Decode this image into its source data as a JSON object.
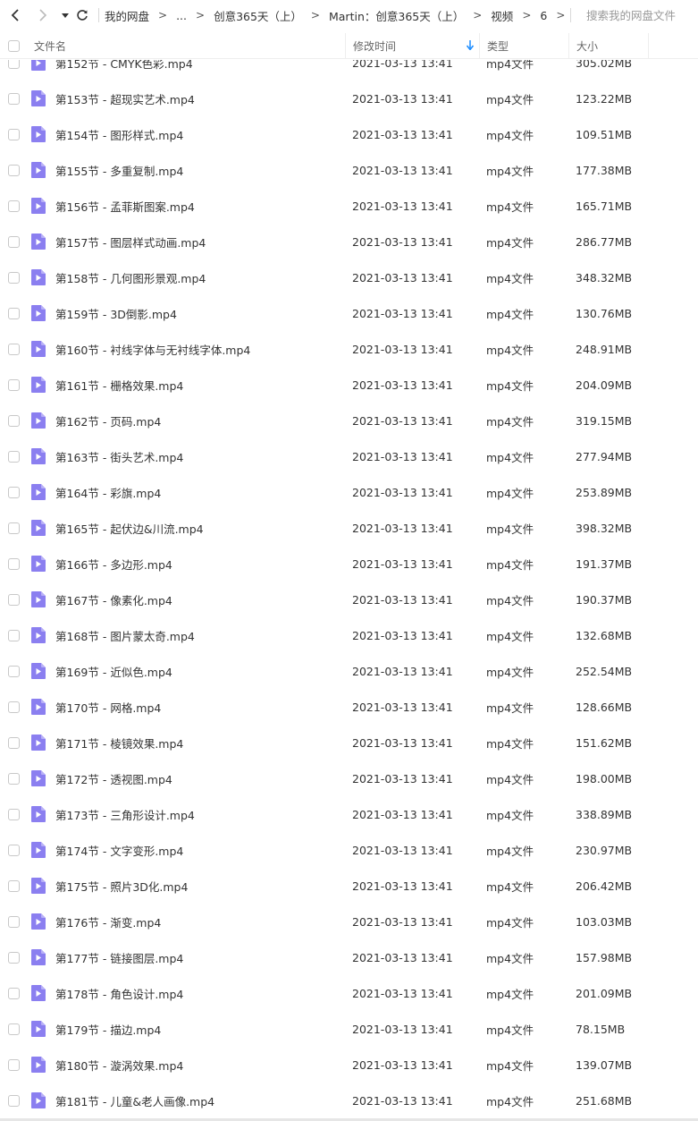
{
  "nav": {
    "back_icon": "chevron-left-icon",
    "forward_icon": "chevron-right-icon",
    "history_icon": "caret-down-icon",
    "refresh_icon": "refresh-icon"
  },
  "breadcrumb": [
    {
      "label": "我的网盘"
    },
    {
      "label": "..."
    },
    {
      "label": "创意365天（上）"
    },
    {
      "label": "Martin：创意365天（上）"
    },
    {
      "label": "视频"
    },
    {
      "label": "6"
    }
  ],
  "search": {
    "placeholder": "搜索我的网盘文件"
  },
  "columns": {
    "name": "文件名",
    "time": "修改时间",
    "type": "类型",
    "size": "大小"
  },
  "files": [
    {
      "name": "第152节 - CMYK色彩.mp4",
      "time": "2021-03-13 13:41",
      "type": "mp4文件",
      "size": "305.02MB"
    },
    {
      "name": "第153节 - 超现实艺术.mp4",
      "time": "2021-03-13 13:41",
      "type": "mp4文件",
      "size": "123.22MB"
    },
    {
      "name": "第154节 - 图形样式.mp4",
      "time": "2021-03-13 13:41",
      "type": "mp4文件",
      "size": "109.51MB"
    },
    {
      "name": "第155节 - 多重复制.mp4",
      "time": "2021-03-13 13:41",
      "type": "mp4文件",
      "size": "177.38MB"
    },
    {
      "name": "第156节 - 孟菲斯图案.mp4",
      "time": "2021-03-13 13:41",
      "type": "mp4文件",
      "size": "165.71MB"
    },
    {
      "name": "第157节 - 图层样式动画.mp4",
      "time": "2021-03-13 13:41",
      "type": "mp4文件",
      "size": "286.77MB"
    },
    {
      "name": "第158节 - 几何图形景观.mp4",
      "time": "2021-03-13 13:41",
      "type": "mp4文件",
      "size": "348.32MB"
    },
    {
      "name": "第159节 - 3D倒影.mp4",
      "time": "2021-03-13 13:41",
      "type": "mp4文件",
      "size": "130.76MB"
    },
    {
      "name": "第160节 - 衬线字体与无衬线字体.mp4",
      "time": "2021-03-13 13:41",
      "type": "mp4文件",
      "size": "248.91MB"
    },
    {
      "name": "第161节 - 栅格效果.mp4",
      "time": "2021-03-13 13:41",
      "type": "mp4文件",
      "size": "204.09MB"
    },
    {
      "name": "第162节 - 页码.mp4",
      "time": "2021-03-13 13:41",
      "type": "mp4文件",
      "size": "319.15MB"
    },
    {
      "name": "第163节 - 街头艺术.mp4",
      "time": "2021-03-13 13:41",
      "type": "mp4文件",
      "size": "277.94MB"
    },
    {
      "name": "第164节 - 彩旗.mp4",
      "time": "2021-03-13 13:41",
      "type": "mp4文件",
      "size": "253.89MB"
    },
    {
      "name": "第165节 - 起伏边&川流.mp4",
      "time": "2021-03-13 13:41",
      "type": "mp4文件",
      "size": "398.32MB"
    },
    {
      "name": "第166节 - 多边形.mp4",
      "time": "2021-03-13 13:41",
      "type": "mp4文件",
      "size": "191.37MB"
    },
    {
      "name": "第167节 - 像素化.mp4",
      "time": "2021-03-13 13:41",
      "type": "mp4文件",
      "size": "190.37MB"
    },
    {
      "name": "第168节 - 图片蒙太奇.mp4",
      "time": "2021-03-13 13:41",
      "type": "mp4文件",
      "size": "132.68MB"
    },
    {
      "name": "第169节 - 近似色.mp4",
      "time": "2021-03-13 13:41",
      "type": "mp4文件",
      "size": "252.54MB"
    },
    {
      "name": "第170节 - 网格.mp4",
      "time": "2021-03-13 13:41",
      "type": "mp4文件",
      "size": "128.66MB"
    },
    {
      "name": "第171节 - 棱镜效果.mp4",
      "time": "2021-03-13 13:41",
      "type": "mp4文件",
      "size": "151.62MB"
    },
    {
      "name": "第172节 - 透视图.mp4",
      "time": "2021-03-13 13:41",
      "type": "mp4文件",
      "size": "198.00MB"
    },
    {
      "name": "第173节 - 三角形设计.mp4",
      "time": "2021-03-13 13:41",
      "type": "mp4文件",
      "size": "338.89MB"
    },
    {
      "name": "第174节 - 文字变形.mp4",
      "time": "2021-03-13 13:41",
      "type": "mp4文件",
      "size": "230.97MB"
    },
    {
      "name": "第175节 - 照片3D化.mp4",
      "time": "2021-03-13 13:41",
      "type": "mp4文件",
      "size": "206.42MB"
    },
    {
      "name": "第176节 - 渐变.mp4",
      "time": "2021-03-13 13:41",
      "type": "mp4文件",
      "size": "103.03MB"
    },
    {
      "name": "第177节 - 链接图层.mp4",
      "time": "2021-03-13 13:41",
      "type": "mp4文件",
      "size": "157.98MB"
    },
    {
      "name": "第178节 - 角色设计.mp4",
      "time": "2021-03-13 13:41",
      "type": "mp4文件",
      "size": "201.09MB"
    },
    {
      "name": "第179节 - 描边.mp4",
      "time": "2021-03-13 13:41",
      "type": "mp4文件",
      "size": "78.15MB"
    },
    {
      "name": "第180节 - 漩涡效果.mp4",
      "time": "2021-03-13 13:41",
      "type": "mp4文件",
      "size": "139.07MB"
    },
    {
      "name": "第181节 - 儿童&老人画像.mp4",
      "time": "2021-03-13 13:41",
      "type": "mp4文件",
      "size": "251.68MB"
    }
  ],
  "colors": {
    "video_icon": "#8b7ff0",
    "sort_arrow": "#1a8cff"
  }
}
